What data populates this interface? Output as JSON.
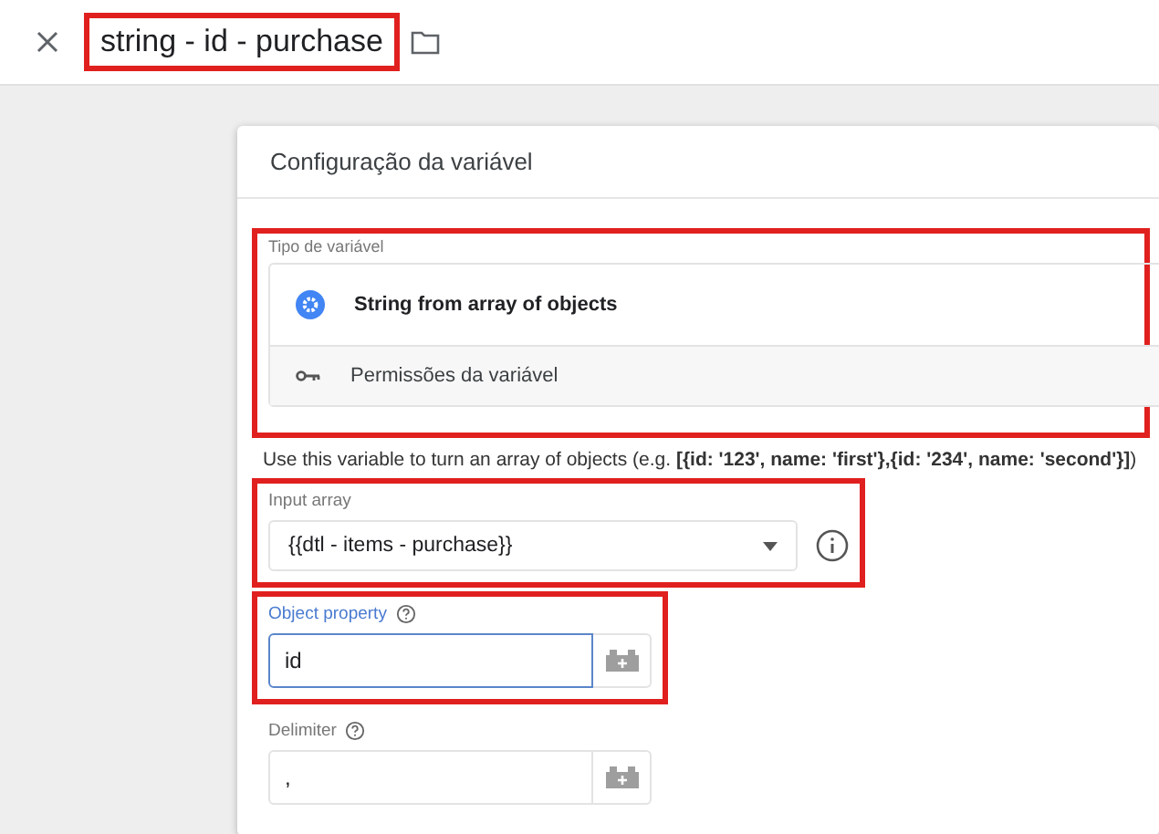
{
  "header": {
    "title": "string - id - purchase",
    "highlighted": true
  },
  "card": {
    "title": "Configuração da variável",
    "variable_type": {
      "highlighted": true,
      "label": "Tipo de variável",
      "type_name": "String from array of objects",
      "permissions": "Permissões da variável"
    },
    "description": "Use this variable to turn an array of objects (e.g. **[{id: '123', name: 'first'},{id: '234', name: 'second'}]**)",
    "fields": [
      {
        "kind": "select",
        "label": "Input array",
        "value": "{{dtl - items - purchase}}",
        "highlighted": true,
        "focused": false
      },
      {
        "kind": "text",
        "label": "Object property",
        "value": "id",
        "highlighted": true,
        "focused": true
      },
      {
        "kind": "text",
        "label": "Delimiter",
        "value": ",",
        "highlighted": false,
        "focused": false
      }
    ]
  }
}
